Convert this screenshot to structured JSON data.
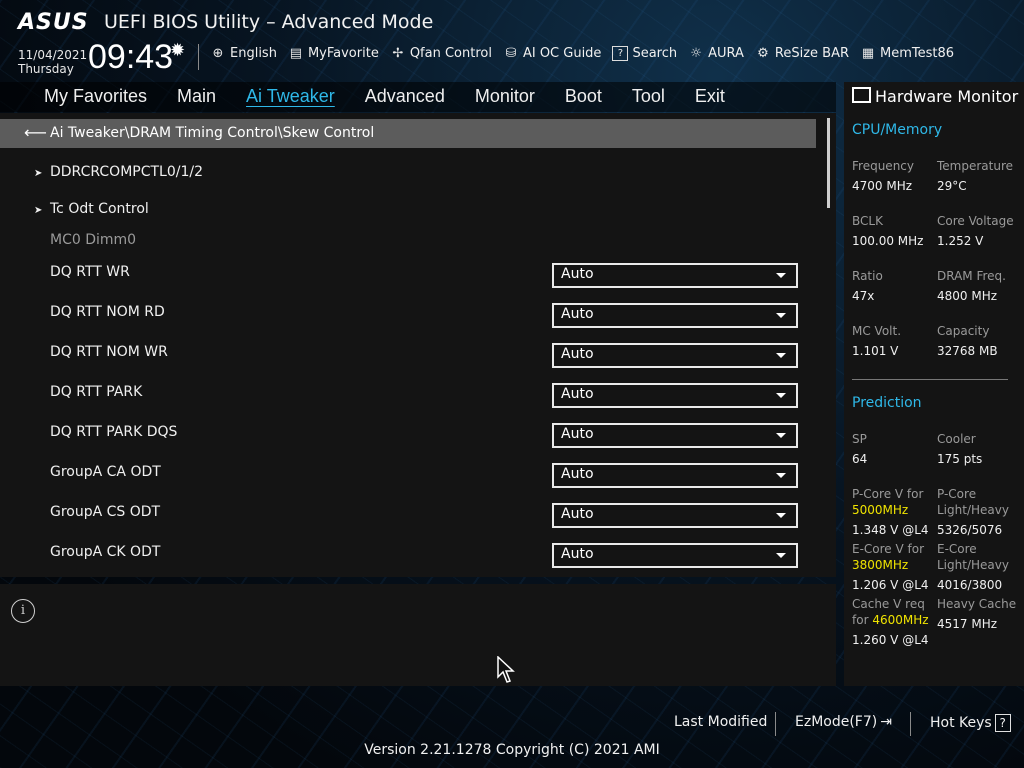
{
  "header": {
    "logo": "ASUS",
    "title": "UEFI BIOS Utility – Advanced Mode",
    "date": "11/04/2021",
    "day": "Thursday",
    "time": "09:43",
    "toolbar": [
      {
        "label": "English",
        "icon": "globe-icon"
      },
      {
        "label": "MyFavorite",
        "icon": "favorite-icon"
      },
      {
        "label": "Qfan Control",
        "icon": "fan-icon"
      },
      {
        "label": "AI OC Guide",
        "icon": "ai-guide-icon"
      },
      {
        "label": "Search",
        "icon": "search-icon"
      },
      {
        "label": "AURA",
        "icon": "aura-icon"
      },
      {
        "label": "ReSize BAR",
        "icon": "resize-bar-icon"
      },
      {
        "label": "MemTest86",
        "icon": "memtest-icon"
      }
    ]
  },
  "nav": {
    "tabs": [
      "My Favorites",
      "Main",
      "Ai Tweaker",
      "Advanced",
      "Monitor",
      "Boot",
      "Tool",
      "Exit"
    ],
    "active": "Ai Tweaker"
  },
  "main": {
    "breadcrumb": "Ai Tweaker\\DRAM Timing Control\\Skew Control",
    "submenus": [
      "DDRCRCOMPCTL0/1/2",
      "Tc Odt Control"
    ],
    "group_label": "MC0 Dimm0",
    "settings": [
      {
        "label": "DQ RTT WR",
        "value": "Auto"
      },
      {
        "label": "DQ RTT NOM RD",
        "value": "Auto"
      },
      {
        "label": "DQ RTT NOM WR",
        "value": "Auto"
      },
      {
        "label": "DQ RTT PARK",
        "value": "Auto"
      },
      {
        "label": "DQ RTT PARK DQS",
        "value": "Auto"
      },
      {
        "label": "GroupA CA ODT",
        "value": "Auto"
      },
      {
        "label": "GroupA CS ODT",
        "value": "Auto"
      },
      {
        "label": "GroupA CK ODT",
        "value": "Auto"
      }
    ]
  },
  "info": {
    "icon": "info-icon"
  },
  "hardware_monitor": {
    "title": "Hardware Monitor",
    "cpu_memory": {
      "heading": "CPU/Memory",
      "items": [
        {
          "label": "Frequency",
          "value": "4700 MHz"
        },
        {
          "label": "Temperature",
          "value": "29°C"
        },
        {
          "label": "BCLK",
          "value": "100.00 MHz"
        },
        {
          "label": "Core Voltage",
          "value": "1.252 V"
        },
        {
          "label": "Ratio",
          "value": "47x"
        },
        {
          "label": "DRAM Freq.",
          "value": "4800 MHz"
        },
        {
          "label": "MC Volt.",
          "value": "1.101 V"
        },
        {
          "label": "Capacity",
          "value": "32768 MB"
        }
      ]
    },
    "prediction": {
      "heading": "Prediction",
      "sp_label": "SP",
      "sp_value": "64",
      "cooler_label": "Cooler",
      "cooler_value": "175 pts",
      "pcore_v_label": "P-Core V for",
      "pcore_v_freq": "5000MHz",
      "pcore_v_value": "1.348 V @L4",
      "pcore_lh_label": "P-Core Light/Heavy",
      "pcore_lh_value": "5326/5076",
      "ecore_v_label": "E-Core V for",
      "ecore_v_freq": "3800MHz",
      "ecore_v_value": "1.206 V @L4",
      "ecore_lh_label": "E-Core Light/Heavy",
      "ecore_lh_value": "4016/3800",
      "cache_v_label": "Cache V req for",
      "cache_v_freq": "4600MHz",
      "cache_v_value": "1.260 V @L4",
      "heavy_cache_label": "Heavy Cache",
      "heavy_cache_value": "4517 MHz"
    }
  },
  "footer": {
    "last_modified": "Last Modified",
    "ezmode": "EzMode(F7)",
    "hot_keys": "Hot Keys",
    "hot_keys_key": "?",
    "version": "Version 2.21.1278 Copyright (C) 2021 AMI"
  },
  "colors": {
    "accent": "#2fb8e8",
    "highlight": "#f0e400",
    "panel": "#141414",
    "breadcrumb_bar": "#5c5c5c"
  }
}
